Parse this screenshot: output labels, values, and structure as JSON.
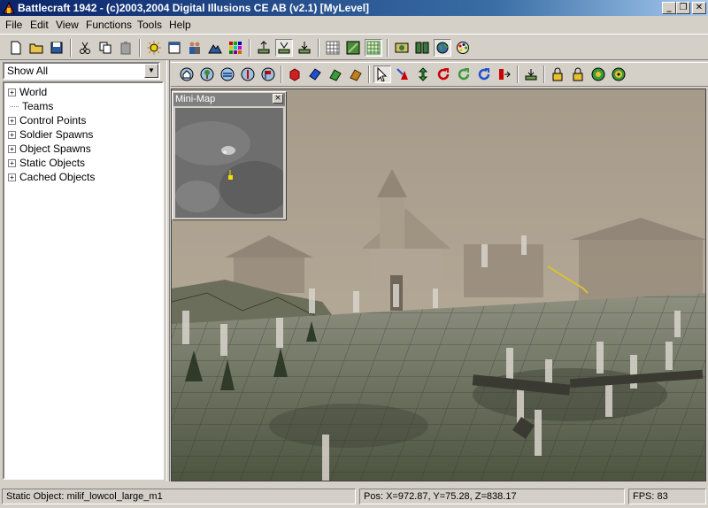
{
  "window": {
    "title": "Battlecraft 1942 - (c)2003,2004 Digital Illusions CE AB (v2.1) [MyLevel]",
    "minimize_label": "_",
    "restore_label": "❐",
    "close_label": "✕"
  },
  "menu": [
    "File",
    "Edit",
    "View",
    "Functions",
    "Tools",
    "Help"
  ],
  "filter": {
    "selected": "Show All"
  },
  "tree": [
    {
      "label": "World",
      "expandable": true
    },
    {
      "label": "Teams",
      "expandable": false
    },
    {
      "label": "Control Points",
      "expandable": true
    },
    {
      "label": "Soldier Spawns",
      "expandable": true
    },
    {
      "label": "Object Spawns",
      "expandable": true
    },
    {
      "label": "Static Objects",
      "expandable": true
    },
    {
      "label": "Cached Objects",
      "expandable": true
    }
  ],
  "minimap": {
    "title": "Mini-Map",
    "close_label": "×"
  },
  "status": {
    "object": "Static Object: milif_lowcol_large_m1",
    "position": "Pos: X=972.87, Y=75.28, Z=838.17",
    "fps": "FPS: 83"
  },
  "colors": {
    "titlebar": "#0a246a",
    "chrome": "#d4d0c8",
    "fog": "#b5a896",
    "ground": "#5d6650"
  }
}
